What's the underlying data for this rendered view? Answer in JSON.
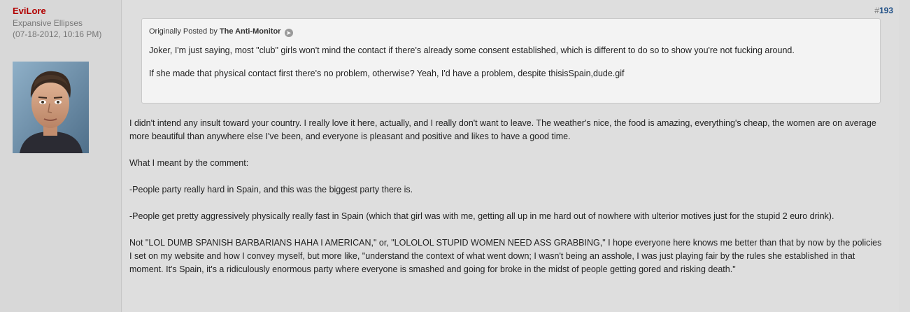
{
  "user": {
    "name": "EviLore",
    "title": "Expansive Ellipses",
    "date": "(07-18-2012, 10:16 PM)"
  },
  "post": {
    "number_prefix": "#",
    "number": "193"
  },
  "quote": {
    "originally_posted_by": "Originally Posted by",
    "author": "The Anti-Monitor",
    "paragraphs": [
      "Joker, I'm just saying, most \"club\" girls won't mind the contact if there's already some consent established, which is different to do so to show you're not fucking around.",
      "If she made that physical contact first there's no problem, otherwise? Yeah, I'd have a problem, despite thisisSpain,dude.gif"
    ]
  },
  "message": {
    "paragraphs": [
      "I didn't intend any insult toward your country. I really love it here, actually, and I really don't want to leave. The weather's nice, the food is amazing, everything's cheap, the women are on average more beautiful than anywhere else I've been, and everyone is pleasant and positive and likes to have a good time.",
      "What I meant by the comment:",
      "-People party really hard in Spain, and this was the biggest party there is.",
      "-People get pretty aggressively physically really fast in Spain (which that girl was with me, getting all up in me hard out of nowhere with ulterior motives just for the stupid 2 euro drink).",
      "Not \"LOL DUMB SPANISH BARBARIANS HAHA I AMERICAN,\" or, \"LOLOLOL STUPID WOMEN NEED ASS GRABBING,\" I hope everyone here knows me better than that by now by the policies I set on my website and how I convey myself, but more like, \"understand the context of what went down; I wasn't being an asshole, I was just playing fair by the rules she established in that moment. It's Spain, it's a ridiculously enormous party where everyone is smashed and going for broke in the midst of people getting gored and risking death.\""
    ]
  },
  "icons": {
    "view_post": "view-post-arrow-icon",
    "avatar": "avatar-photo"
  },
  "colors": {
    "username": "#b20000",
    "post_number": "#1f4f86",
    "quote_bg": "#f3f3f3",
    "post_bg": "#dedede"
  }
}
